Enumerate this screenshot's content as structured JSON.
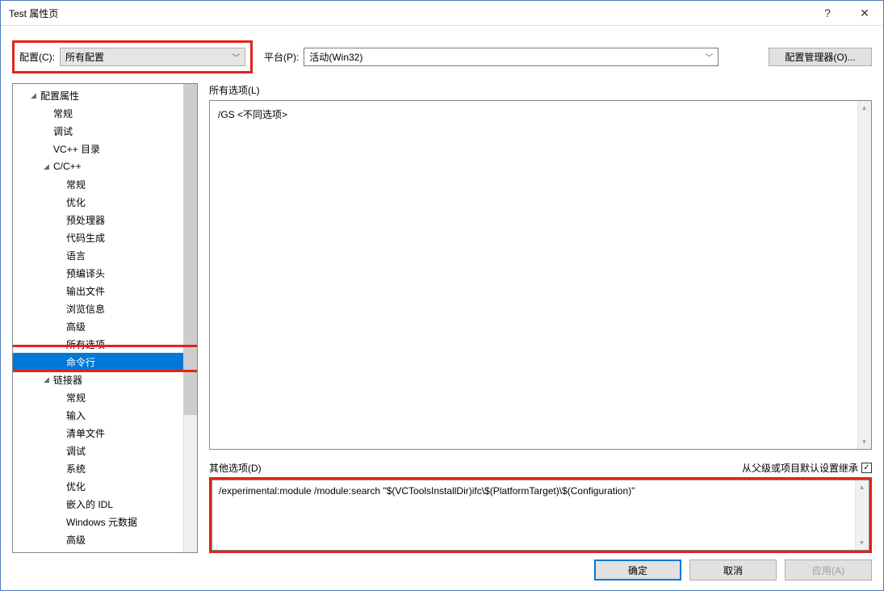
{
  "window": {
    "title": "Test 属性页"
  },
  "toprow": {
    "config_label": "配置(C):",
    "config_value": "所有配置",
    "platform_label": "平台(P):",
    "platform_value": "活动(Win32)",
    "manager_btn": "配置管理器(O)..."
  },
  "tree": {
    "items": [
      {
        "label": "配置属性",
        "indent": 1,
        "caret": "◢"
      },
      {
        "label": "常规",
        "indent": 2,
        "caret": ""
      },
      {
        "label": "调试",
        "indent": 2,
        "caret": ""
      },
      {
        "label": "VC++ 目录",
        "indent": 2,
        "caret": ""
      },
      {
        "label": "C/C++",
        "indent": 2,
        "caret": "◢"
      },
      {
        "label": "常规",
        "indent": 3,
        "caret": ""
      },
      {
        "label": "优化",
        "indent": 3,
        "caret": ""
      },
      {
        "label": "预处理器",
        "indent": 3,
        "caret": ""
      },
      {
        "label": "代码生成",
        "indent": 3,
        "caret": ""
      },
      {
        "label": "语言",
        "indent": 3,
        "caret": ""
      },
      {
        "label": "预编译头",
        "indent": 3,
        "caret": ""
      },
      {
        "label": "输出文件",
        "indent": 3,
        "caret": ""
      },
      {
        "label": "浏览信息",
        "indent": 3,
        "caret": ""
      },
      {
        "label": "高级",
        "indent": 3,
        "caret": ""
      },
      {
        "label": "所有选项",
        "indent": 3,
        "caret": ""
      },
      {
        "label": "命令行",
        "indent": 3,
        "caret": "",
        "selected": true
      },
      {
        "label": "链接器",
        "indent": 2,
        "caret": "◢"
      },
      {
        "label": "常规",
        "indent": 3,
        "caret": ""
      },
      {
        "label": "输入",
        "indent": 3,
        "caret": ""
      },
      {
        "label": "清单文件",
        "indent": 3,
        "caret": ""
      },
      {
        "label": "调试",
        "indent": 3,
        "caret": ""
      },
      {
        "label": "系统",
        "indent": 3,
        "caret": ""
      },
      {
        "label": "优化",
        "indent": 3,
        "caret": ""
      },
      {
        "label": "嵌入的 IDL",
        "indent": 3,
        "caret": ""
      },
      {
        "label": "Windows 元数据",
        "indent": 3,
        "caret": ""
      },
      {
        "label": "高级",
        "indent": 3,
        "caret": ""
      }
    ]
  },
  "right": {
    "all_options_label": "所有选项(L)",
    "all_options_value": "/GS <不同选项>",
    "other_options_label": "其他选项(D)",
    "inherit_label": "从父级或项目默认设置继承",
    "other_options_value": "/experimental:module  /module:search \"$(VCToolsInstallDir)ifc\\$(PlatformTarget)\\$(Configuration)\""
  },
  "footer": {
    "ok": "确定",
    "cancel": "取消",
    "apply": "应用(A)"
  }
}
